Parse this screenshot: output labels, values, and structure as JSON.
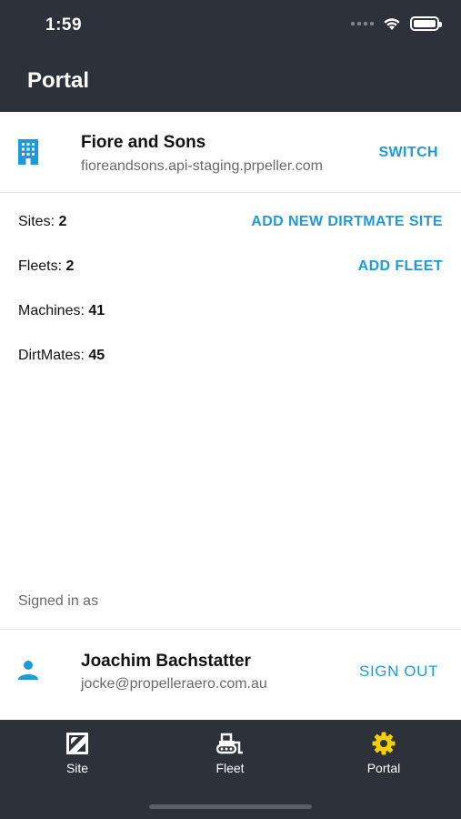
{
  "status_bar": {
    "time": "1:59"
  },
  "header": {
    "title": "Portal"
  },
  "company": {
    "name": "Fiore and Sons",
    "domain": "fioreandsons.api-staging.prpeller.com",
    "switch_label": "SWITCH"
  },
  "stats": {
    "sites_label": "Sites:",
    "sites_value": "2",
    "fleets_label": "Fleets:",
    "fleets_value": "2",
    "machines_label": "Machines:",
    "machines_value": "41",
    "dirtmates_label": "DirtMates:",
    "dirtmates_value": "45"
  },
  "actions": {
    "add_site_label": "ADD NEW DIRTMATE SITE",
    "add_fleet_label": "ADD FLEET"
  },
  "account": {
    "signed_in_label": "Signed in as",
    "name": "Joachim Bachstatter",
    "email": "jocke@propelleraero.com.au",
    "sign_out_label": "SIGN OUT"
  },
  "tabs": [
    {
      "label": "Site",
      "icon": "map-icon",
      "active": false
    },
    {
      "label": "Fleet",
      "icon": "bulldozer-icon",
      "active": false
    },
    {
      "label": "Portal",
      "icon": "gear-icon",
      "active": true
    }
  ],
  "colors": {
    "header_bg": "#2c313a",
    "accent": "#1e9bd7",
    "active_tab": "#f5d000"
  }
}
